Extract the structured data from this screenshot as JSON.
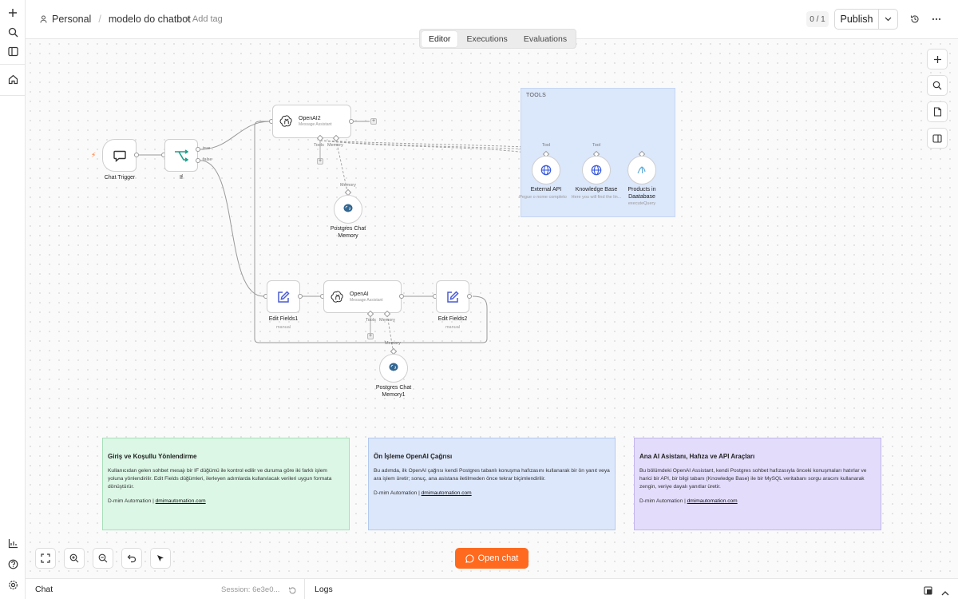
{
  "header": {
    "workspace": "Personal",
    "separator": "/",
    "workflow_name": "modelo do chatbot",
    "add_tag": "+ Add tag",
    "version_counter": "0 / 1",
    "publish_label": "Publish"
  },
  "tabs": [
    {
      "label": "Editor",
      "active": true
    },
    {
      "label": "Executions",
      "active": false
    },
    {
      "label": "Evaluations",
      "active": false
    }
  ],
  "canvas": {
    "tools_group_label": "TOOLS",
    "nodes": {
      "chat_trigger": {
        "label": "Chat Trigger"
      },
      "if": {
        "label": "If",
        "true_label": "true",
        "false_label": "false"
      },
      "openai2": {
        "title": "OpenAI2",
        "subtitle": "Message Assistant",
        "tools_label": "Tools",
        "memory_label": "Memory"
      },
      "postgres_memory": {
        "label": "Postgres Chat Memory",
        "edge_label": "Memory"
      },
      "external_api": {
        "label": "External API",
        "sub": "Pegue o nome completo",
        "edge_label": "Tool"
      },
      "knowledge_base": {
        "label": "Knowledge Base",
        "sub": "Here you will find the lin...",
        "edge_label": "Tool"
      },
      "products_db": {
        "label": "Products in Daatabase",
        "sub": "executeQuery"
      },
      "edit_fields1": {
        "label": "Edit Fields1",
        "sub": "manual"
      },
      "openai": {
        "title": "OpenAI",
        "subtitle": "Message Assistant",
        "tools_label": "Tools",
        "memory_label": "Memory"
      },
      "edit_fields2": {
        "label": "Edit Fields2",
        "sub": "manual"
      },
      "postgres_memory1": {
        "label": "Postgres Chat Memory1",
        "edge_label": "Memory"
      }
    },
    "sticky_notes": [
      {
        "title": "Giriş ve Koşullu Yönlendirme",
        "body": "Kullanıcıdan gelen sohbet mesajı bir IF düğümü ile kontrol edilir ve duruma göre iki farklı işlem yoluna yönlendirilir. Edit Fields düğümleri, ilerleyen adımlarda kullanılacak verileri uygun formata dönüştürür.",
        "footer_text": "D-mim Automation |",
        "footer_link": "dmimautomation.com",
        "color": "#dcf7e6"
      },
      {
        "title": "Ön İşleme OpenAI Çağrısı",
        "body": "Bu adımda, ilk OpenAI çağrısı kendi Postgres tabanlı konuşma hafızasını kullanarak bir ön yanıt veya ara işlem üretir; sonuç, ana asistana iletilmeden önce tekrar biçimlendirilir.",
        "footer_text": "D-mim Automation |",
        "footer_link": "dmimautomation.com",
        "color": "#dce7fb"
      },
      {
        "title": "Ana AI Asistanı, Hafıza ve API Araçları",
        "body": "Bu bölümdeki OpenAI Assistant, kendi Postgres sohbet hafızasıyla önceki konuşmaları hatırlar ve harici bir API, bir bilgi tabanı (Knowledge Base) ile bir MySQL veritabanı sorgu aracını kullanarak zengin, veriye dayalı yanıtlar üretir.",
        "footer_text": "D-mim Automation |",
        "footer_link": "dmimautomation.com",
        "color": "#e3dcfb"
      }
    ],
    "open_chat_label": "Open chat"
  },
  "bottom_panel": {
    "chat_label": "Chat",
    "session_label": "Session: 6e3e0...",
    "logs_label": "Logs"
  },
  "colors": {
    "accent": "#ff6a1f",
    "tools_group": "#dbe7fb",
    "if_icon": "#1f9e8a",
    "edit_icon": "#4a5bd4",
    "globe_icon": "#3b5bdb"
  }
}
